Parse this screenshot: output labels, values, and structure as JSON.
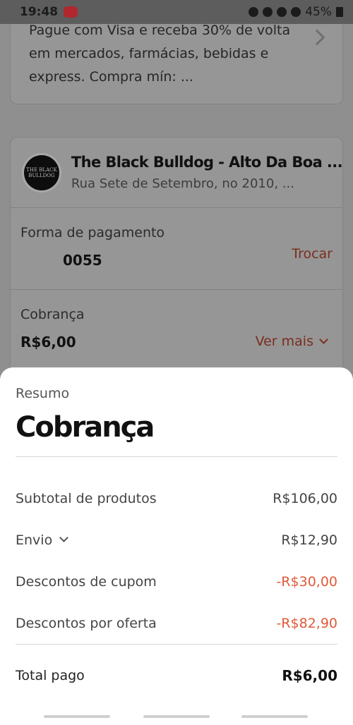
{
  "status_bar": {
    "time": "19:48",
    "battery": "45%"
  },
  "promo": {
    "text": "Pague com Visa e receba 30% de volta em mercados, farmácias, bebidas e express. Compra mín: ..."
  },
  "store": {
    "logo_text": "THE BLACK BULLDOG",
    "name": "The Black Bulldog - Alto Da Boa ...",
    "address": "Rua Sete de Setembro, no 2010, ..."
  },
  "payment": {
    "label": "Forma de pagamento",
    "card": "0055",
    "change_label": "Trocar"
  },
  "charge": {
    "label": "Cobrança",
    "amount": "R$6,00",
    "more_label": "Ver mais"
  },
  "sheet": {
    "subtitle": "Resumo",
    "title": "Cobrança",
    "lines": [
      {
        "label": "Subtotal de produtos",
        "value": "R$106,00"
      },
      {
        "label": "Envio",
        "value": "R$12,90"
      },
      {
        "label": "Descontos de cupom",
        "value": "-R$30,00"
      },
      {
        "label": "Descontos por oferta",
        "value": "-R$82,90"
      }
    ],
    "total_label": "Total pago",
    "total_value": "R$6,00"
  },
  "colors": {
    "discount": "#e05a3a",
    "link": "#ee4d2d"
  }
}
